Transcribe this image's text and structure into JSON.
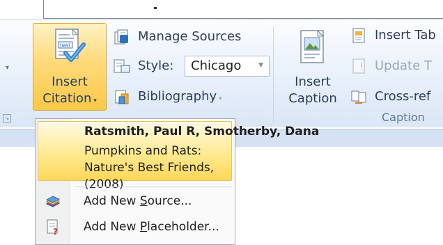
{
  "ribbon": {
    "insert_citation": {
      "line1": "Insert",
      "line2": "Citation"
    },
    "manage_sources": "Manage Sources",
    "style_label": "Style:",
    "style_value": "Chicago",
    "bibliography": "Bibliography",
    "insert_caption": {
      "line1": "Insert",
      "line2": "Caption"
    },
    "insert_table": "Insert Tab",
    "update_table": "Update T",
    "cross_reference": "Cross-ref",
    "captions_group": "Caption"
  },
  "citation_dropdown": {
    "entries": [
      {
        "authors": "Ratsmith, Paul R,  Smotherby, Dana",
        "title": "Pumpkins and Rats: Nature's Best Friends, (2008)"
      }
    ],
    "add_new_source": {
      "prefix": "Add New ",
      "accel": "S",
      "suffix": "ource..."
    },
    "add_new_placeholder": {
      "prefix": "Add New ",
      "accel": "P",
      "suffix": "laceholder..."
    }
  },
  "icons": {
    "insert_citation": "insert-citation-icon",
    "manage_sources": "manage-sources-icon",
    "style": "style-icon",
    "bibliography": "bibliography-icon",
    "insert_caption": "insert-caption-icon",
    "insert_table": "insert-table-of-figures-icon",
    "update_table": "update-table-icon",
    "cross_reference": "cross-reference-icon",
    "add_new_source": "add-new-source-icon",
    "add_new_placeholder": "add-new-placeholder-icon"
  },
  "colors": {
    "ribbon_bg": "#dbe6f5",
    "hover_gold": "#fbc947",
    "text": "#2b3f5d",
    "menu_bg": "#fafafa"
  }
}
